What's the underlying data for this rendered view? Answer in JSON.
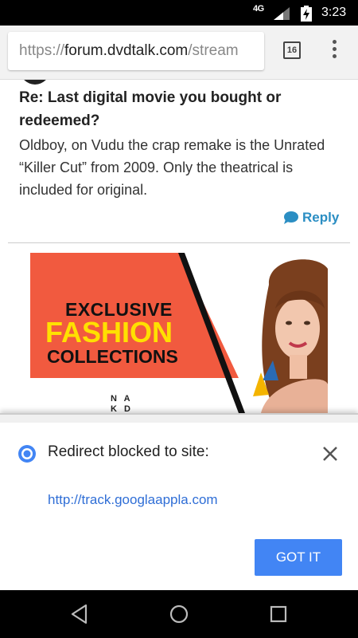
{
  "status_bar": {
    "network": "4G",
    "time": "3:23",
    "signal_icon": "cell-signal-icon",
    "battery_icon": "battery-charging-icon"
  },
  "browser": {
    "url_scheme": "https://",
    "url_host": "forum.dvdtalk.com",
    "url_path": "/stream",
    "tab_count": "16",
    "menu_icon": "more-vert-icon"
  },
  "post": {
    "title": "Re: Last digital movie you bought or redeemed?",
    "body": "Oldboy, on Vudu the crap remake is the Unrated “Killer Cut” from 2009. Only the theatrical is included for original.",
    "reply_label": "Reply",
    "reply_icon": "speech-bubble-icon"
  },
  "ad": {
    "line1": "EXCLUSIVE",
    "line2": "FASHION",
    "line3": "COLLECTIONS",
    "logo_row1": "N A",
    "logo_row2": "K D",
    "colors": {
      "panel": "#f15a3f",
      "highlight": "#ffe000"
    }
  },
  "infobar": {
    "message": "Redirect blocked to site:",
    "link": "http://track.googlaappla.com",
    "button_label": "GOT IT",
    "accent": "#4285f4"
  },
  "nav": {
    "back_icon": "back-triangle-icon",
    "home_icon": "home-circle-icon",
    "recents_icon": "recents-square-icon"
  }
}
